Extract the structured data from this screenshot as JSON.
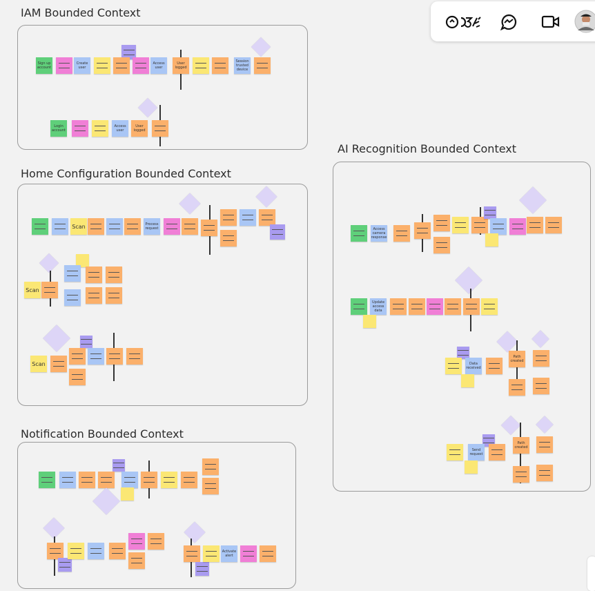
{
  "contexts": {
    "iam": "IAM Bounded Context",
    "home": "Home Configuration Bounded Context",
    "notification": "Notification Bounded Context",
    "ai": "AI Recognition Bounded Context"
  },
  "notes": {
    "signup": "Sign up account",
    "create_user": "Create user",
    "access_user": "Access user",
    "user_logged": "User logged",
    "session_trusted": "Session trusted device",
    "login_account": "Login account",
    "access_user_2": "Access user",
    "user_logged_2": "User logged",
    "scan_1": "Scan",
    "process_request": "Process request",
    "scan_2": "Scan",
    "scan_3": "Scan",
    "access_camera": "Access camera response",
    "update_access": "Update access data",
    "data_received": "Data received",
    "path_created": "Path created",
    "send_request": "Send request",
    "path_created_2": "Path created",
    "activate_alert": "Activate alert"
  },
  "toolbar": {
    "reactions_icon": "reactions-icon",
    "chat_icon": "messenger-icon",
    "video_icon": "video-camera-icon",
    "avatar": "user-avatar"
  },
  "colors": {
    "green": "#5fcf7a",
    "pink": "#f07fd6",
    "yellow": "#fbe774",
    "orange": "#fbb06b",
    "blue": "#a9c6f5",
    "purple": "#a99bf0",
    "hotspot": "#ddd5f7"
  }
}
